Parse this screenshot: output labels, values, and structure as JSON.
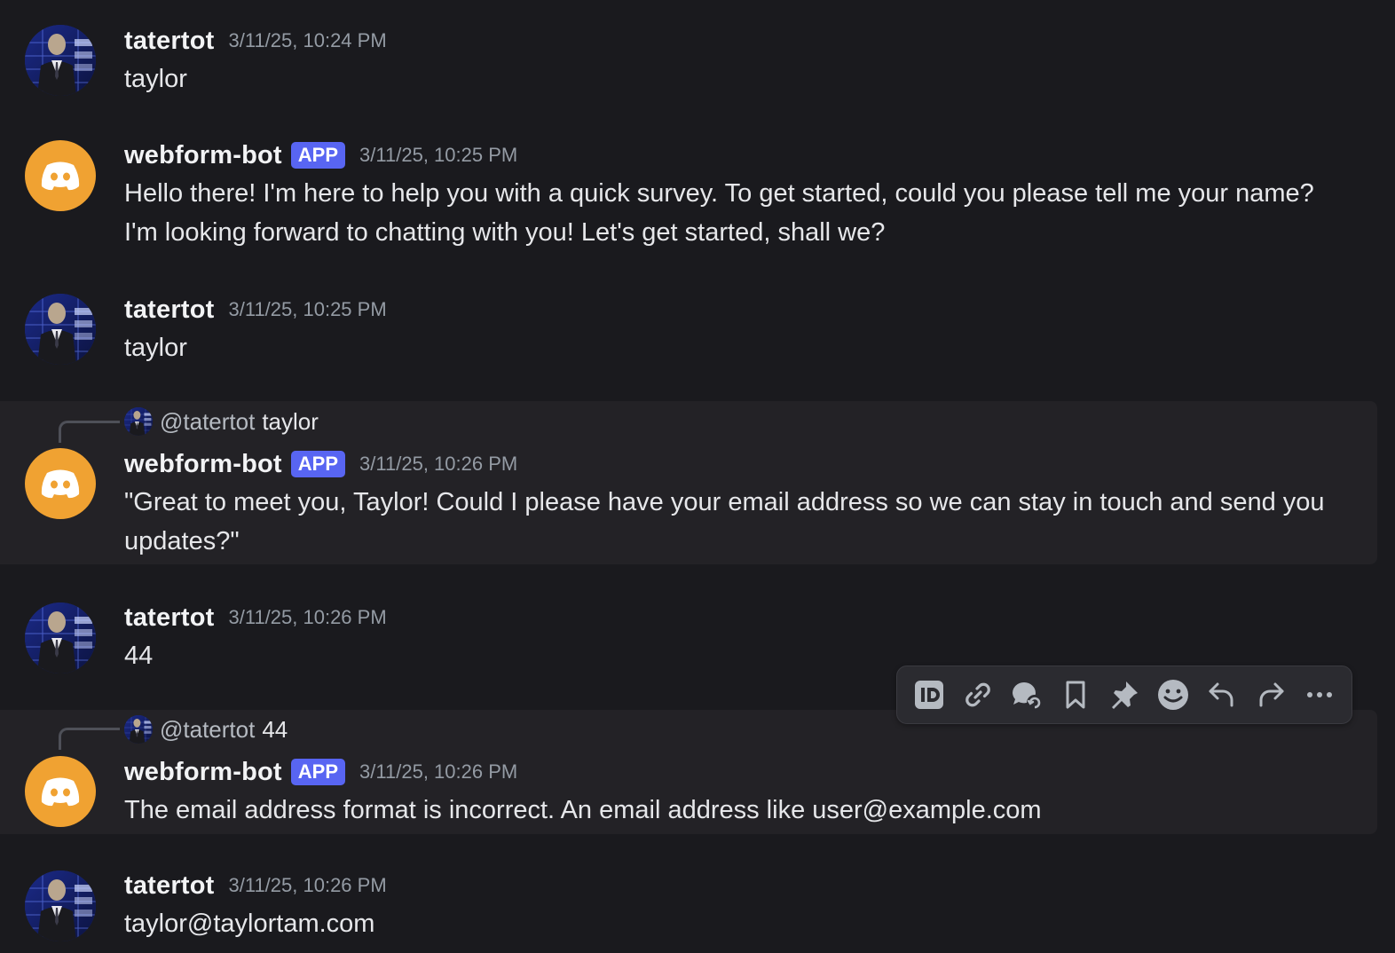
{
  "colors": {
    "background": "#1a1a1e",
    "highlight_row": "#232226",
    "app_badge": "#5865f2",
    "bot_avatar": "#f0a232",
    "timestamp": "#949ba4"
  },
  "messages": [
    {
      "author": "tatertot",
      "timestamp": "3/11/25, 10:24 PM",
      "text": "taylor"
    },
    {
      "author": "webform-bot",
      "badge": "APP",
      "timestamp": "3/11/25, 10:25 PM",
      "text": "Hello there! I'm here to help you with a quick survey. To get started, could you please tell me your name? I'm looking forward to chatting with you! Let's get started, shall we?"
    },
    {
      "author": "tatertot",
      "timestamp": "3/11/25, 10:25 PM",
      "text": "taylor"
    },
    {
      "author": "webform-bot",
      "badge": "APP",
      "timestamp": "3/11/25, 10:26 PM",
      "reply_to": {
        "mention": "@tatertot",
        "text": "taylor"
      },
      "text": "\"Great to meet you, Taylor! Could I please have your email address so we can stay in touch and send you updates?\""
    },
    {
      "author": "tatertot",
      "timestamp": "3/11/25, 10:26 PM",
      "text": "44"
    },
    {
      "author": "webform-bot",
      "badge": "APP",
      "timestamp": "3/11/25, 10:26 PM",
      "reply_to": {
        "mention": "@tatertot",
        "text": "44"
      },
      "text": "The email address format is incorrect. An email address like user@example.com"
    },
    {
      "author": "tatertot",
      "timestamp": "3/11/25, 10:26 PM",
      "text": "taylor@taylortam.com"
    }
  ],
  "toolbar": {
    "icons": [
      "id-icon",
      "link-icon",
      "thread-icon",
      "bookmark-icon",
      "pin-icon",
      "emoji-icon",
      "reply-icon",
      "forward-icon",
      "more-icon"
    ]
  }
}
